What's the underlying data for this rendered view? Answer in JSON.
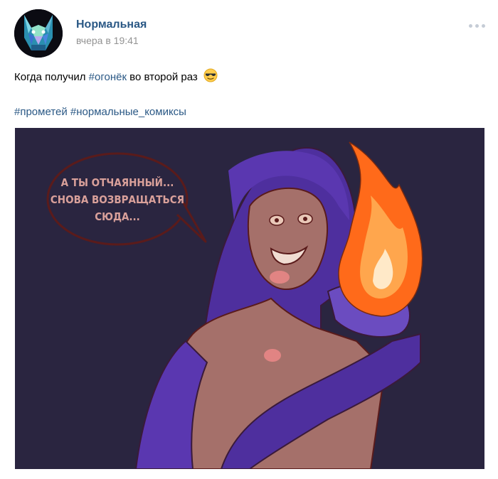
{
  "post": {
    "author": "Нормальная",
    "date": "вчера в 19:41",
    "text_before": "Когда получил ",
    "text_hashtag": "#огонёк",
    "text_after": " во второй раз",
    "emoji": "sunglasses-emoji",
    "hashtags": [
      "#прометей",
      "#нормальные_комиксы"
    ],
    "image": {
      "speech_bubble": [
        "А ТЫ ОТЧАЯННЫЙ...",
        "СНОВА ВОЗВРАЩАТЬСЯ",
        "СЮДА..."
      ]
    }
  },
  "colors": {
    "link": "#2a5885",
    "muted": "#939393",
    "image_bg": "#2a2540",
    "figure": "#4e2f9e",
    "skin": "#a5706a",
    "fire": "#ff6a1a",
    "bubble_text": "#d9a09a"
  }
}
